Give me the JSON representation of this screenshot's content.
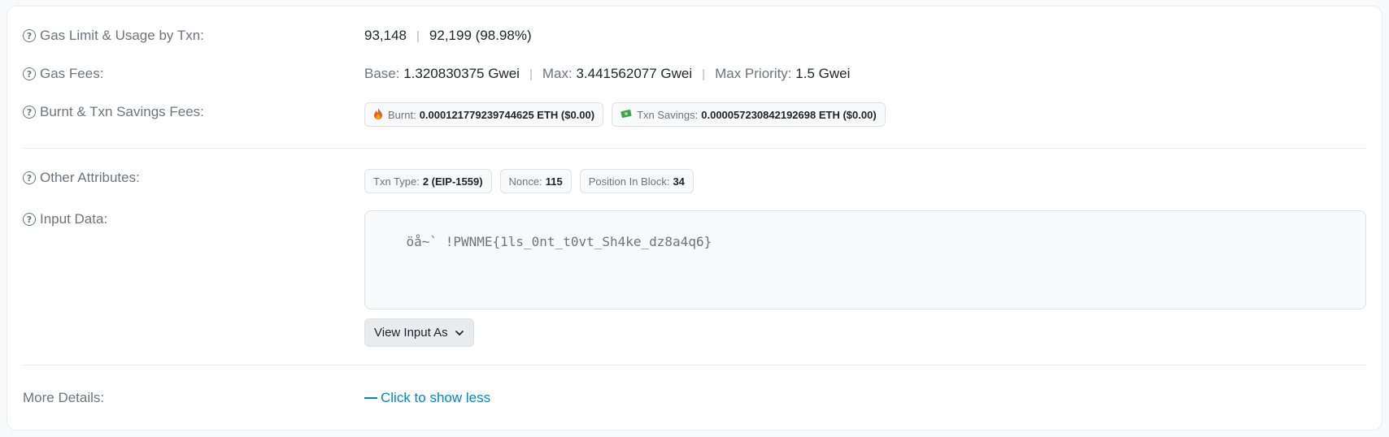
{
  "rows": {
    "gas_limit": {
      "label": "Gas Limit & Usage by Txn:",
      "limit": "93,148",
      "usage": "92,199 (98.98%)"
    },
    "gas_fees": {
      "label": "Gas Fees:",
      "base_label": "Base:",
      "base_value": "1.320830375 Gwei",
      "max_label": "Max:",
      "max_value": "3.441562077 Gwei",
      "priority_label": "Max Priority:",
      "priority_value": "1.5 Gwei"
    },
    "burnt": {
      "label": "Burnt & Txn Savings Fees:",
      "burnt_icon": "fire-icon",
      "burnt_label": "Burnt:",
      "burnt_value": "0.000121779239744625 ETH ($0.00)",
      "savings_icon": "money-icon",
      "savings_label": "Txn Savings:",
      "savings_value": "0.000057230842192698 ETH ($0.00)"
    },
    "other": {
      "label": "Other Attributes:",
      "txn_type_label": "Txn Type:",
      "txn_type_value": "2 (EIP-1559)",
      "nonce_label": "Nonce:",
      "nonce_value": "115",
      "position_label": "Position In Block:",
      "position_value": "34"
    },
    "input": {
      "label": "Input Data:",
      "value": "öå~` !PWNME{1ls_0nt_t0vt_Sh4ke_dz8a4q6}",
      "button_label": "View Input As"
    },
    "more": {
      "label": "More Details:",
      "link_label": "Click to show less"
    }
  },
  "colors": {
    "link": "#0784c3",
    "muted": "#6c757d"
  }
}
